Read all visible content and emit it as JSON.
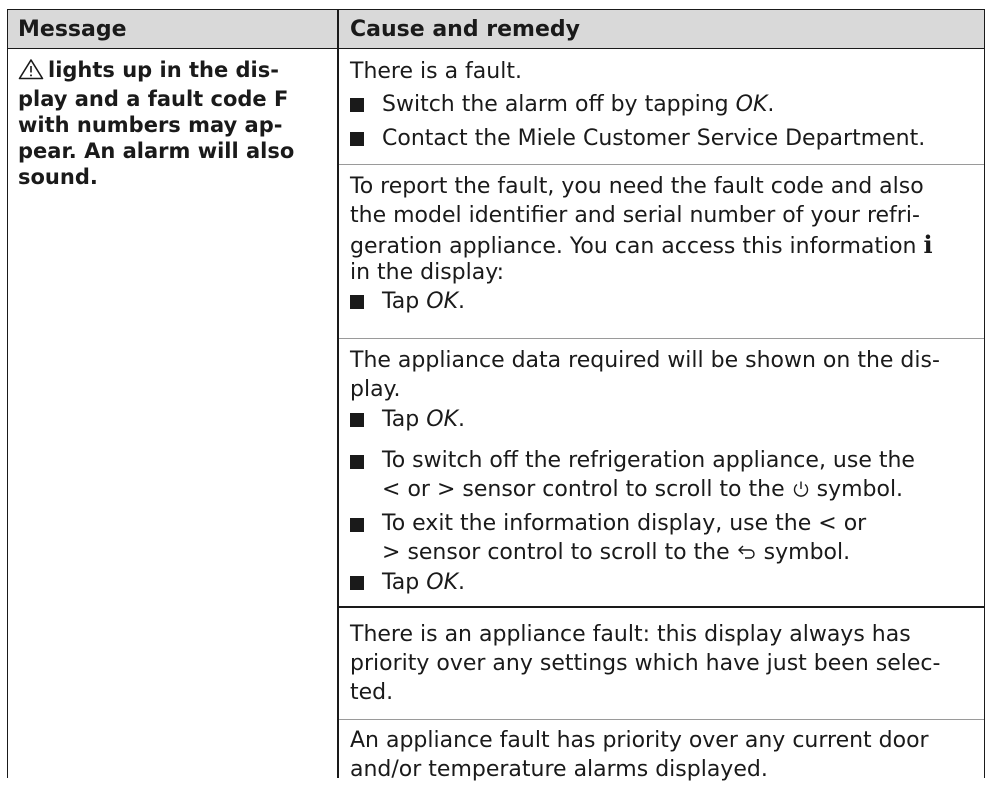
{
  "header": {
    "message": "Message",
    "cause": "Cause and remedy"
  },
  "message": {
    "icon": "warning-triangle-icon",
    "lines": [
      "lights up in the dis-",
      "play and a fault code F",
      "with numbers may ap-",
      "pear. An alarm will also",
      "sound."
    ]
  },
  "block1": {
    "intro": "There is a fault.",
    "b1_pre": "Switch the alarm off by tapping ",
    "b1_it": "OK",
    "b1_post": ".",
    "b2": "Contact the Miele Customer Service Department."
  },
  "block2": {
    "l1": "To report the fault, you need the fault code and also",
    "l2": "the model identifier and serial number of your refri-",
    "l3": "geration appliance. You can access this information",
    "info_icon": "info-icon",
    "l4": "in the display:",
    "b_pre": "Tap ",
    "b_it": "OK",
    "b_post": "."
  },
  "block3": {
    "l1": "The appliance data required will be shown on the dis-",
    "l2": "play.",
    "b1_pre": "Tap ",
    "b1_it": "OK",
    "b1_post": ".",
    "b2_l1": "To switch off the refrigeration appliance, use the",
    "b2_l2_a": "or",
    "b2_l2_b": "sensor control to scroll to the",
    "b2_l2_c": "symbol.",
    "b3_l1": "To exit the information display, use the",
    "b3_l1_b": "or",
    "b3_l2_a": "sensor control to scroll to the",
    "b3_l2_b": "symbol.",
    "b4_pre": "Tap ",
    "b4_it": "OK",
    "b4_post": ".",
    "left_chevron": "<",
    "right_chevron": ">",
    "power_icon": "power-icon",
    "back_icon": "back-arrow-icon"
  },
  "block4": {
    "l1": "There is an appliance fault: this display always has",
    "l2": "priority over any settings which have just been selec-",
    "l3": "ted."
  },
  "block5": {
    "l1": "An appliance fault has priority over any current door",
    "l2": "and/or temperature alarms displayed."
  }
}
